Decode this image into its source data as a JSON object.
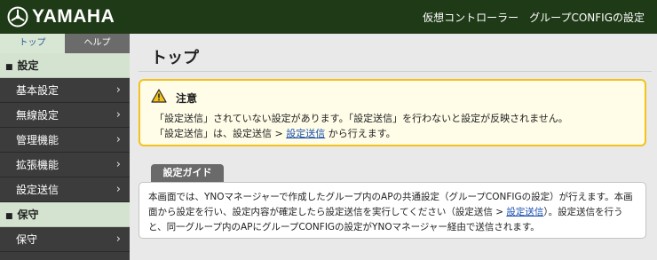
{
  "header": {
    "logo_text": "YAMAHA",
    "title": "仮想コントローラー　グループCONFIGの設定"
  },
  "sidebar": {
    "tabs": [
      {
        "label": "トップ"
      },
      {
        "label": "ヘルプ"
      }
    ],
    "sections": [
      {
        "label": "設定",
        "items": [
          {
            "label": "基本設定"
          },
          {
            "label": "無線設定"
          },
          {
            "label": "管理機能"
          },
          {
            "label": "拡張機能"
          },
          {
            "label": "設定送信"
          }
        ]
      },
      {
        "label": "保守",
        "items": [
          {
            "label": "保守"
          }
        ]
      }
    ]
  },
  "main": {
    "page_title": "トップ",
    "notice": {
      "title": "注意",
      "line1": "「設定送信」されていない設定があります。「設定送信」を行わないと設定が反映されません。",
      "line2_prefix": "「設定送信」は、設定送信 > ",
      "line2_link": "設定送信",
      "line2_suffix": " から行えます。"
    },
    "guide": {
      "tab_label": "設定ガイド",
      "text_part1": "本画面では、YNOマネージャーで作成したグループ内のAPの共通設定（グループCONFIGの設定）が行えます。本画面から設定を行い、設定内容が確定したら設定送信を実行してください（設定送信 > ",
      "link": "設定送信",
      "text_part2": "）。設定送信を行うと、同一グループ内のAPにグループCONFIGの設定がYNOマネージャー経由で送信されます。"
    }
  },
  "colors": {
    "header_bg": "#1f3a17",
    "sidebar_bg": "#3c3c3c",
    "section_bg": "#d3e3cf",
    "notice_border": "#f2c21b",
    "link": "#1a4fb0"
  },
  "icons": {
    "logo": "yamaha-tuning-fork-logo",
    "warning": "warning-triangle-icon",
    "chevron": "chevron-right-icon",
    "section_marker": "square-bullet"
  }
}
